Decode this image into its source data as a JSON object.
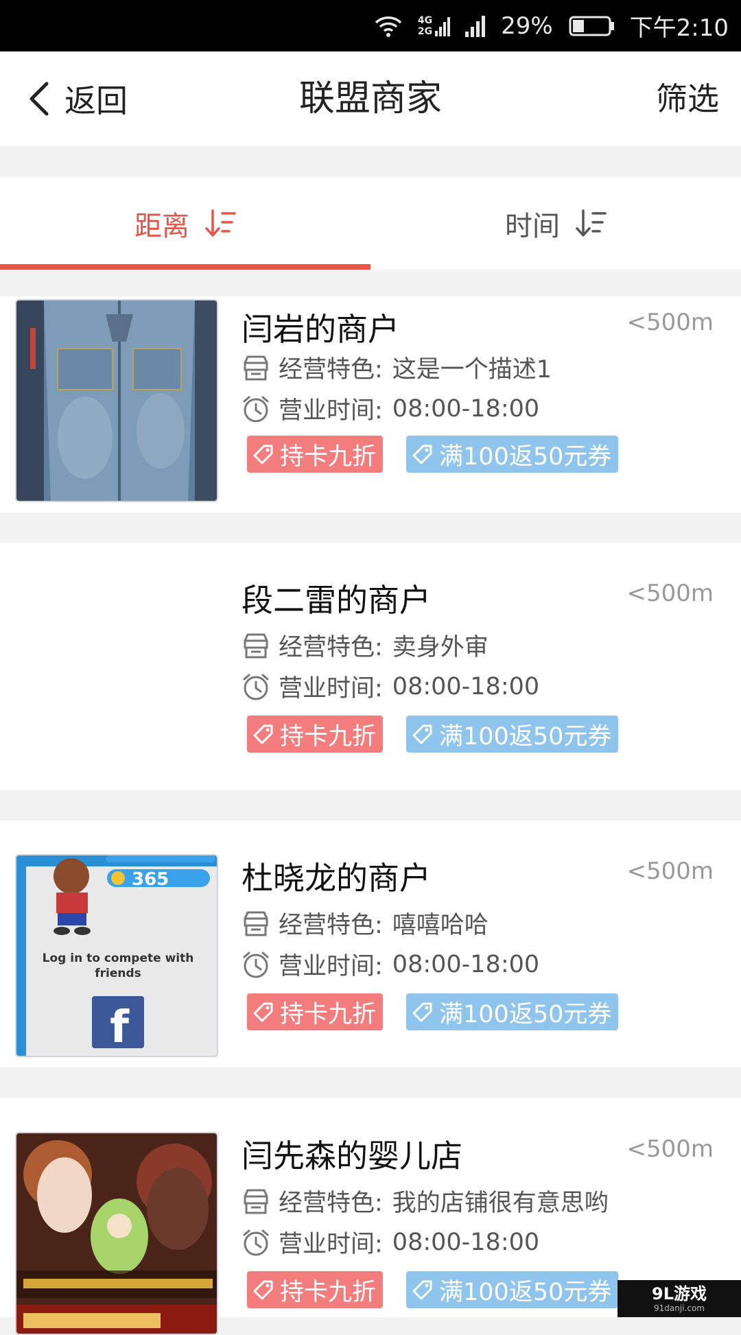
{
  "status_bar": {
    "network": "4G",
    "network2": "2G",
    "battery": "29%",
    "time": "下午2:10"
  },
  "nav": {
    "back_label": "返回",
    "title": "联盟商家",
    "filter_label": "筛选"
  },
  "sort_tabs": [
    {
      "label": "距离",
      "active": true
    },
    {
      "label": "时间",
      "active": false
    }
  ],
  "labels": {
    "feature": "经营特色:",
    "hours": "营业时间:"
  },
  "merchants": [
    {
      "name": "闫岩的商户",
      "distance": "<500m",
      "feature": "这是一个描述1",
      "hours": "08:00-18:00",
      "tags": [
        "持卡九折",
        "满100返50元券"
      ]
    },
    {
      "name": "段二雷的商户",
      "distance": "<500m",
      "feature": "卖身外审",
      "hours": "08:00-18:00",
      "tags": [
        "持卡九折",
        "满100返50元券"
      ]
    },
    {
      "name": "杜晓龙的商户",
      "distance": "<500m",
      "feature": "嘻嘻哈哈",
      "hours": "08:00-18:00",
      "tags": [
        "持卡九折",
        "满100返50元券"
      ]
    },
    {
      "name": "闫先森的婴儿店",
      "distance": "<500m",
      "feature": "我的店铺很有意思哟",
      "hours": "08:00-18:00",
      "tags": [
        "持卡九折",
        "满100返50元券"
      ]
    }
  ],
  "thumb_texts": {
    "score": "365",
    "login": "Log in to compete with friends",
    "fb": "f"
  },
  "watermark": {
    "main": "9L游戏",
    "sub": "91danji.com"
  },
  "colors": {
    "accent": "#e85445",
    "discount_tag": "#f37d7d",
    "coupon_tag": "#8fc4ec"
  }
}
